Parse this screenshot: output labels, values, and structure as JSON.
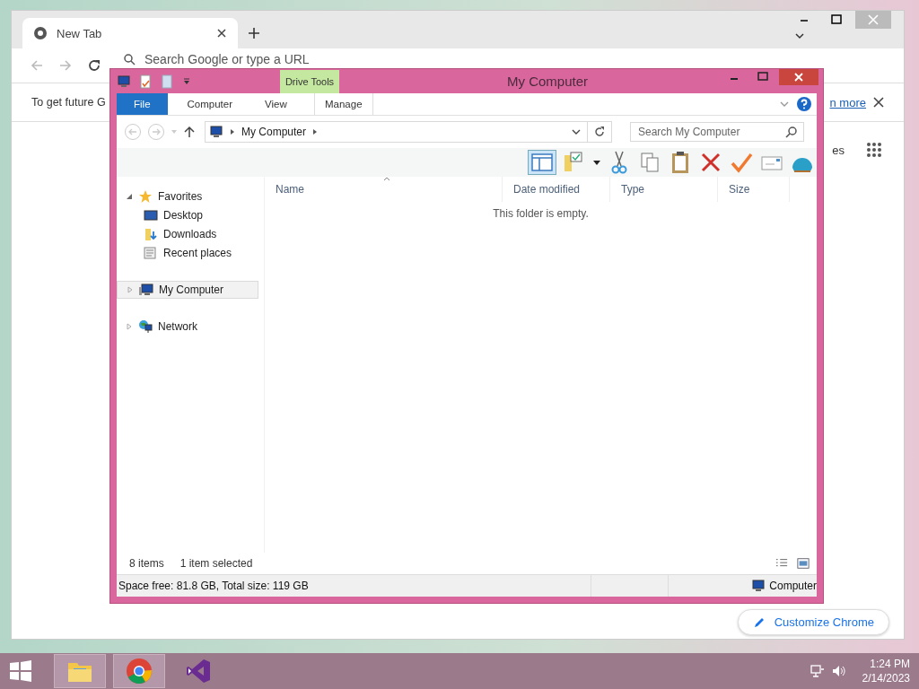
{
  "chrome": {
    "tabs": [
      {
        "label": "New Tab",
        "selected": true
      }
    ],
    "address_placeholder": "Search Google or type a URL",
    "infobar": {
      "text": "To get future G",
      "link": "n more"
    },
    "shortcut_fragment": "es",
    "customize_button": "Customize Chrome"
  },
  "explorer": {
    "title": "My Computer",
    "contextual_group": "Drive Tools",
    "ribbon_tabs": [
      {
        "label": "File",
        "kind": "file"
      },
      {
        "label": "Computer",
        "kind": "tab"
      },
      {
        "label": "View",
        "kind": "tab"
      },
      {
        "label": "Manage",
        "kind": "contextual"
      }
    ],
    "breadcrumb": [
      "My Computer"
    ],
    "search_placeholder": "Search My Computer",
    "nav": [
      {
        "label": "Favorites",
        "kind": "favorites",
        "selected": false,
        "expanded": true,
        "children": [
          {
            "label": "Desktop",
            "kind": "desktop",
            "selected": false
          },
          {
            "label": "Downloads",
            "kind": "downloads",
            "selected": false
          },
          {
            "label": "Recent places",
            "kind": "recent",
            "selected": false
          }
        ]
      },
      {
        "label": "My Computer",
        "kind": "computer",
        "selected": true,
        "expanded": false
      },
      {
        "label": "Network",
        "kind": "network",
        "selected": false,
        "expanded": false
      }
    ],
    "columns": [
      {
        "label": "Name",
        "sorted": true
      },
      {
        "label": "Date modified",
        "sorted": false
      },
      {
        "label": "Type",
        "sorted": false
      },
      {
        "label": "Size",
        "sorted": false
      }
    ],
    "empty_message": "This folder is empty.",
    "status": {
      "items": "8 items",
      "selection": "1 item selected"
    },
    "details_bar": {
      "space": "Space free: 81.8 GB, Total size: 119 GB",
      "location": "Computer"
    }
  },
  "taskbar": {
    "apps": [
      {
        "kind": "files",
        "running": true
      },
      {
        "kind": "browser",
        "running": true
      },
      {
        "kind": "studio",
        "running": false
      }
    ],
    "time": "1:24 PM",
    "date": "2/14/2023"
  }
}
